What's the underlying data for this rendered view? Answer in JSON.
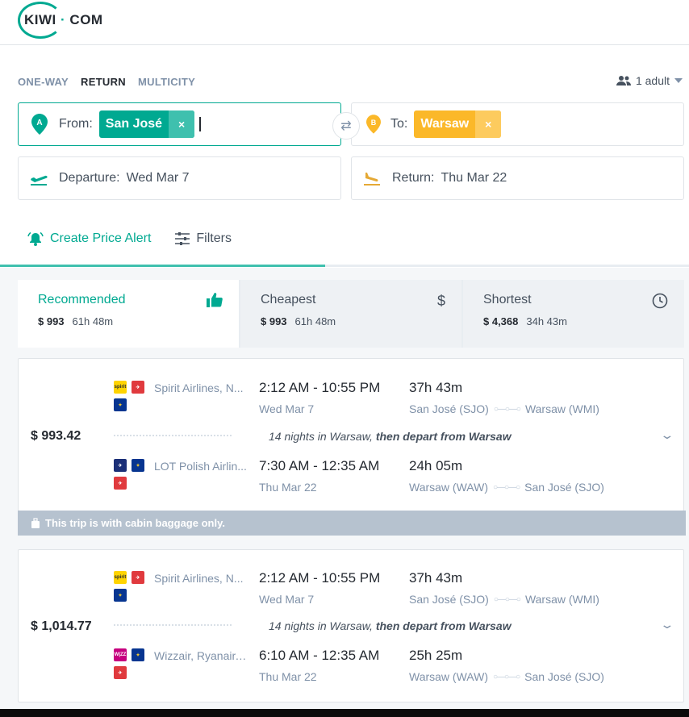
{
  "header": {
    "logo_left": "KIWI",
    "logo_dot": "·",
    "logo_right": "COM"
  },
  "search": {
    "trip_types": [
      "ONE-WAY",
      "RETURN",
      "MULTICITY"
    ],
    "active_trip_type": "RETURN",
    "passengers": "1 adult",
    "from": {
      "label": "From:",
      "badge": "A",
      "value": "San José"
    },
    "to": {
      "label": "To:",
      "badge": "B",
      "value": "Warsaw"
    },
    "departure": {
      "label": "Departure:",
      "value": "Wed Mar 7"
    },
    "return": {
      "label": "Return:",
      "value": "Thu Mar 22"
    },
    "chip_remove": "×",
    "swap_icon": "⇄"
  },
  "actions": {
    "price_alert": "Create Price Alert",
    "filters": "Filters"
  },
  "sort_tabs": [
    {
      "title": "Recommended",
      "price": "$ 993",
      "duration": "61h 48m",
      "icon": "thumbs-up-icon",
      "active": true
    },
    {
      "title": "Cheapest",
      "price": "$ 993",
      "duration": "61h 48m",
      "icon": "dollar-icon",
      "symbol": "$"
    },
    {
      "title": "Shortest",
      "price": "$ 4,368",
      "duration": "34h 43m",
      "icon": "clock-icon"
    }
  ],
  "results": [
    {
      "price": "$ 993.42",
      "outbound": {
        "carrier": "Spirit Airlines, N...",
        "times": "2:12 AM - 10:55 PM",
        "date": "Wed Mar 7",
        "duration": "37h 43m",
        "from": "San José (SJO)",
        "to": "Warsaw (WMI)"
      },
      "stay": {
        "prefix": "14 nights in Warsaw, ",
        "suffix": "then depart from Warsaw"
      },
      "inbound": {
        "carrier": "LOT Polish Airlin...",
        "times": "7:30 AM - 12:35 AM",
        "date": "Thu Mar 22",
        "duration": "24h 05m",
        "from": "Warsaw (WAW)",
        "to": "San José (SJO)"
      },
      "note": "This trip is with cabin baggage only."
    },
    {
      "price": "$ 1,014.77",
      "outbound": {
        "carrier": "Spirit Airlines, N...",
        "times": "2:12 AM - 10:55 PM",
        "date": "Wed Mar 7",
        "duration": "37h 43m",
        "from": "San José (SJO)",
        "to": "Warsaw (WMI)"
      },
      "stay": {
        "prefix": "14 nights in Warsaw, ",
        "suffix": "then depart from Warsaw"
      },
      "inbound": {
        "carrier": "Wizzair, Ryanair, ...",
        "times": "6:10 AM - 12:35 AM",
        "date": "Thu Mar 22",
        "duration": "25h 25m",
        "from": "Warsaw (WAW)",
        "to": "San José (SJO)"
      }
    }
  ],
  "airline_logo_text": {
    "spirit": "spirit",
    "wizz": "W|ZZ"
  },
  "colors": {
    "accent": "#00a991",
    "orange": "#fbb829",
    "text": "#46515e",
    "muted": "#7f91a8"
  }
}
